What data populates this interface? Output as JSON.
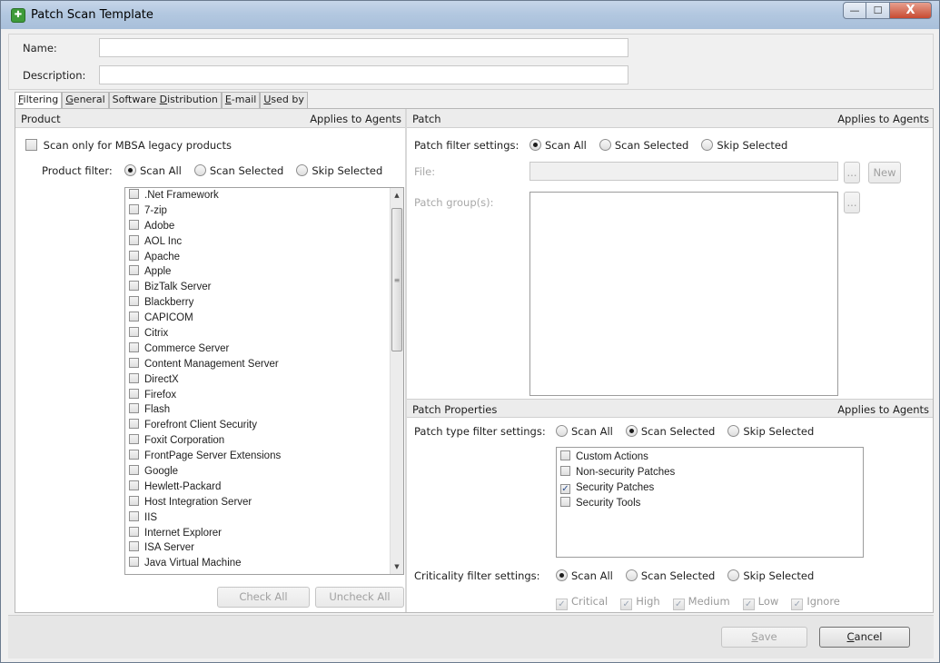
{
  "window": {
    "title": "Patch Scan Template",
    "min": "—",
    "max": "☐",
    "close": "X"
  },
  "form": {
    "name_label": "Name:",
    "name_value": "",
    "description_label": "Description:",
    "description_value": ""
  },
  "tabs": [
    {
      "pre": "",
      "ul": "F",
      "post": "iltering"
    },
    {
      "pre": "",
      "ul": "G",
      "post": "eneral"
    },
    {
      "pre": "Software ",
      "ul": "D",
      "post": "istribution"
    },
    {
      "pre": "",
      "ul": "E",
      "post": "-mail"
    },
    {
      "pre": "",
      "ul": "U",
      "post": "sed by"
    }
  ],
  "product_section": {
    "header": "Product",
    "applies": "Applies to Agents",
    "mbsa_label": "Scan only for MBSA legacy products",
    "filter_label": "Product filter:",
    "filter_options": [
      "Scan All",
      "Scan Selected",
      "Skip Selected"
    ],
    "filter_selected": "Scan All",
    "products": [
      ".Net Framework",
      "7-zip",
      "Adobe",
      "AOL Inc",
      "Apache",
      "Apple",
      "BizTalk Server",
      "Blackberry",
      "CAPICOM",
      "Citrix",
      "Commerce Server",
      "Content Management Server",
      "DirectX",
      "Firefox",
      "Flash",
      "Forefront Client Security",
      "Foxit Corporation",
      "FrontPage Server Extensions",
      "Google",
      "Hewlett-Packard",
      "Host Integration Server",
      "IIS",
      "Internet Explorer",
      "ISA Server",
      "Java Virtual Machine"
    ],
    "check_all": "Check All",
    "uncheck_all": "Uncheck All"
  },
  "patch_section": {
    "header": "Patch",
    "applies": "Applies to Agents",
    "filter_label": "Patch filter settings:",
    "filter_options": [
      "Scan All",
      "Scan Selected",
      "Skip Selected"
    ],
    "filter_selected": "Scan All",
    "file_label": "File:",
    "file_value": "",
    "browse": "...",
    "new": "New",
    "groups_label": "Patch group(s):",
    "groups_browse": "..."
  },
  "patch_properties": {
    "header": "Patch Properties",
    "applies": "Applies to Agents",
    "type_label": "Patch type filter settings:",
    "type_options": [
      "Scan All",
      "Scan Selected",
      "Skip Selected"
    ],
    "type_selected": "Scan Selected",
    "types": [
      {
        "label": "Custom Actions",
        "checked": false
      },
      {
        "label": "Non-security Patches",
        "checked": false
      },
      {
        "label": "Security Patches",
        "checked": true
      },
      {
        "label": "Security Tools",
        "checked": false
      }
    ],
    "criticality_label": "Criticality filter settings:",
    "criticality_options": [
      "Scan All",
      "Scan Selected",
      "Skip Selected"
    ],
    "criticality_selected": "Scan All",
    "levels": [
      "Critical",
      "High",
      "Medium",
      "Low",
      "Ignore"
    ]
  },
  "footer": {
    "save_ul": "S",
    "save_rest": "ave",
    "cancel_ul": "C",
    "cancel_rest": "ancel"
  },
  "colors": {
    "titlebar": "#b3c8e0",
    "close": "#c74a31",
    "icon": "#3e9b3a"
  }
}
